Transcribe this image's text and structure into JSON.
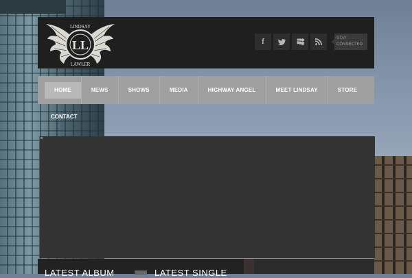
{
  "brand": {
    "logo_top": "LINDSAY",
    "logo_initials": "LL",
    "logo_bottom": "LAWLER"
  },
  "social": {
    "items": [
      {
        "name": "facebook",
        "glyph": "f"
      },
      {
        "name": "twitter",
        "glyph": "t"
      },
      {
        "name": "myspace",
        "glyph": "m"
      },
      {
        "name": "rss",
        "glyph": "rss"
      }
    ],
    "stay_label": "STAY CONNECTED"
  },
  "nav": {
    "items": [
      "HOME",
      "NEWS",
      "SHOWS",
      "MEDIA",
      "HIGHWAY ANGEL",
      "MEET LINDSAY",
      "STORE"
    ],
    "active_index": 0,
    "contact": "CONTACT"
  },
  "sections": {
    "latest_album": "LATEST ALBUM",
    "latest_single": "LATEST SINGLE"
  },
  "colors": {
    "header_bg": "#1f1f1f",
    "nav_bg": "#9f9f9f",
    "slider_bg": "#343434"
  }
}
